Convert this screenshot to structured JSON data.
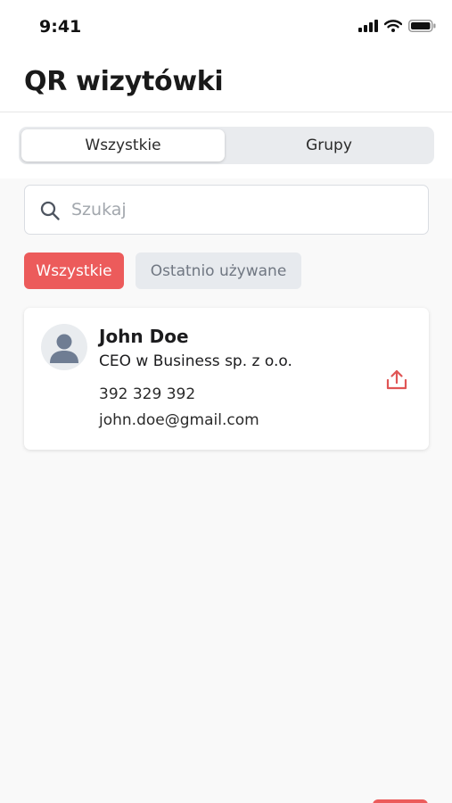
{
  "status_bar": {
    "time": "9:41"
  },
  "header": {
    "title": "QR wizytówki"
  },
  "segments": {
    "all_label": "Wszystkie",
    "groups_label": "Grupy"
  },
  "search": {
    "placeholder": "Szukaj",
    "value": ""
  },
  "filters": {
    "all_label": "Wszystkie",
    "recent_label": "Ostatnio używane"
  },
  "contacts": [
    {
      "name": "John Doe",
      "role": "CEO w Business sp. z o.o.",
      "phone": "392 329 392",
      "email": "john.doe@gmail.com"
    }
  ],
  "icons": {
    "search": "search-icon",
    "avatar": "person-icon",
    "share": "share-icon",
    "signal": "cellular-signal-icon",
    "wifi": "wifi-icon",
    "battery": "battery-icon"
  },
  "colors": {
    "accent": "#ec5b5b",
    "chip_inactive_bg": "#e7eaee",
    "background": "#f9f9f9",
    "avatar_figure": "#6f7d93"
  }
}
